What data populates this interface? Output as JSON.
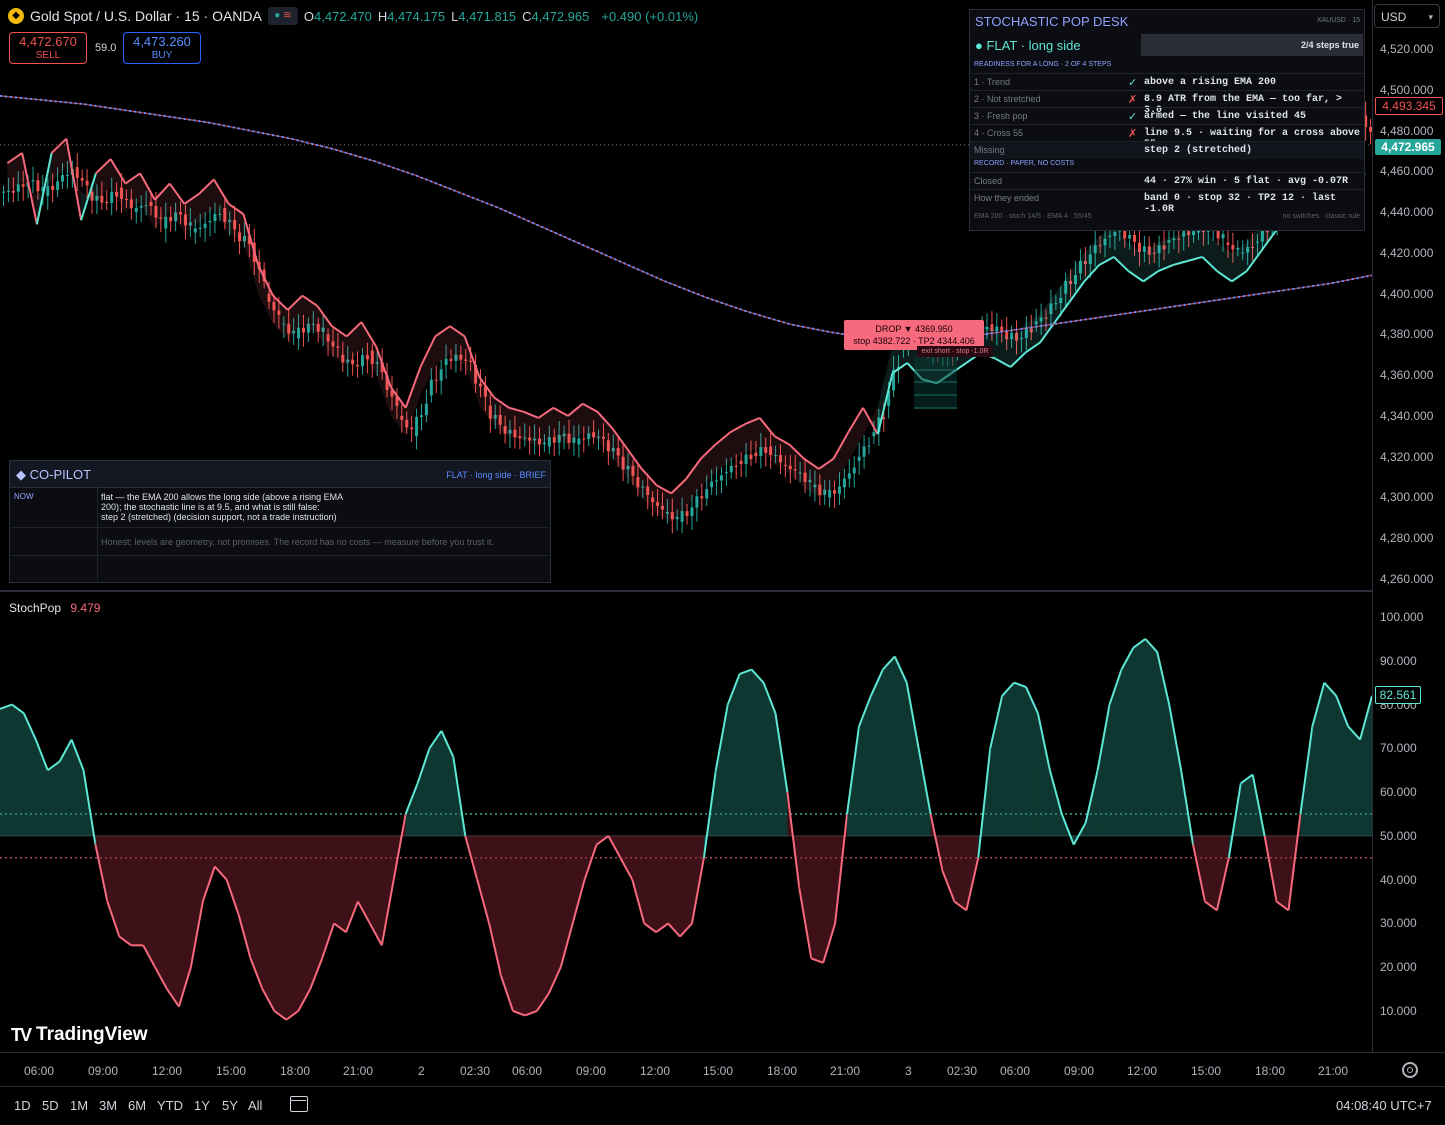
{
  "header": {
    "symbol": "Gold Spot / U.S. Dollar · 15 · OANDA",
    "ohlc": [
      {
        "k": "O",
        "v": "4,472.470"
      },
      {
        "k": "H",
        "v": "4,474.175"
      },
      {
        "k": "L",
        "v": "4,471.815"
      },
      {
        "k": "C",
        "v": "4,472.965"
      }
    ],
    "change": "+0.490 (+0.01%)",
    "sell_price": "4,472.670",
    "sell_label": "SELL",
    "spread": "59.0",
    "buy_price": "4,473.260",
    "buy_label": "BUY",
    "currency": "USD"
  },
  "desk": {
    "title": "STOCHASTIC POP DESK",
    "symbol_tag": "XAUUSD · 15",
    "state": "● FLAT · long side",
    "steps_summary": "2/4 steps true",
    "readiness_header": "READINESS FOR A LONG · 2 OF 4 STEPS",
    "rows": [
      {
        "label": "1 · Trend",
        "mark": "✓",
        "ok": true,
        "value": "above a rising EMA 200"
      },
      {
        "label": "2 · Not stretched",
        "mark": "✗",
        "ok": false,
        "value": "8.9 ATR from the EMA — too far, > 3.0"
      },
      {
        "label": "3 · Fresh pop",
        "mark": "✓",
        "ok": true,
        "value": "armed — the line visited 45"
      },
      {
        "label": "4 · Cross 55",
        "mark": "✗",
        "ok": false,
        "value": "line 9.5 · waiting for a cross above 55"
      },
      {
        "label": "Missing",
        "mark": "",
        "ok": true,
        "value": "step 2 (stretched)"
      }
    ],
    "record_header": "RECORD · PAPER, NO COSTS",
    "record_rows": [
      {
        "label": "Closed",
        "value": "44 · 27% win · 5 flat · avg -0.07R"
      },
      {
        "label": "How they ended",
        "value": "band 0 · stop 32 · TP2 12 · last -1.0R"
      }
    ],
    "footer_left": "EMA 200 · stoch 14/5 · EMA 4 · 55/45",
    "footer_right": "no switches · classic rule"
  },
  "copilot": {
    "title": "◆ CO-PILOT",
    "tag": "FLAT · long side · BRIEF",
    "now_label": "NOW",
    "now_lines": [
      "flat — the EMA 200 allows the long side (above a rising EMA",
      "200); the stochastic line is at 9.5, and what is still false:",
      "step 2 (stretched) (decision support, not a trade instruction)"
    ],
    "honest": "Honest: levels are geometry, not promises. The record has no costs — measure before you trust it."
  },
  "trade_label": {
    "line1": "DROP ▼  4369.950",
    "line2": "stop 4382.722 · TP2 4344.406",
    "exit": "exit short · stop -1.0R"
  },
  "price_axis": {
    "ticks": [
      "4,520.000",
      "4,500.000",
      "4,480.000",
      "4,460.000",
      "4,440.000",
      "4,420.000",
      "4,400.000",
      "4,380.000",
      "4,360.000",
      "4,340.000",
      "4,320.000",
      "4,300.000",
      "4,280.000",
      "4,260.000"
    ],
    "tag_high": "4,493.345",
    "tag_last": "4,472.965"
  },
  "osc": {
    "title": "StochPop",
    "value": "9.479",
    "ticks": [
      "100.000",
      "90.000",
      "80.000",
      "70.000",
      "60.000",
      "50.000",
      "40.000",
      "30.000",
      "20.000",
      "10.000"
    ],
    "tag": "82.561"
  },
  "time_axis": [
    "06:00",
    "09:00",
    "12:00",
    "15:00",
    "18:00",
    "21:00",
    "2",
    "02:30",
    "06:00",
    "09:00",
    "12:00",
    "15:00",
    "18:00",
    "21:00",
    "3",
    "02:30",
    "06:00",
    "09:00",
    "12:00",
    "15:00",
    "18:00",
    "21:00"
  ],
  "ranges": [
    "1D",
    "5D",
    "1M",
    "3M",
    "6M",
    "YTD",
    "1Y",
    "5Y",
    "All"
  ],
  "clock": "04:08:40 UTC+7",
  "brand": "TradingView",
  "colors": {
    "bull": "#26a69a",
    "bear": "#ef5350",
    "accent": "#2962ff",
    "band_up": "#5ee7d5",
    "band_down": "#f7697c"
  },
  "chart_data": [
    {
      "type": "candlestick",
      "title": "Gold Spot / U.S. Dollar · 15 · OANDA",
      "ylim": [
        4255,
        4530
      ],
      "close_path": [
        4450,
        4455,
        4448,
        4455,
        4462,
        4450,
        4445,
        4452,
        4440,
        4445,
        4432,
        4440,
        4430,
        4435,
        4442,
        4430,
        4425,
        4400,
        4385,
        4378,
        4385,
        4380,
        4370,
        4365,
        4372,
        4360,
        4340,
        4330,
        4350,
        4365,
        4370,
        4365,
        4345,
        4335,
        4330,
        4328,
        4325,
        4330,
        4326,
        4332,
        4328,
        4320,
        4310,
        4300,
        4292,
        4288,
        4295,
        4305,
        4312,
        4318,
        4322,
        4325,
        4316,
        4312,
        4305,
        4300,
        4305,
        4318,
        4330,
        4345,
        4375,
        4380,
        4372,
        4370,
        4375,
        4380,
        4385,
        4382,
        4378,
        4385,
        4390,
        4400,
        4410,
        4420,
        4428,
        4432,
        4425,
        4420,
        4425,
        4428,
        4430,
        4432,
        4425,
        4420,
        4425,
        4435,
        4445,
        4455,
        4465,
        4475,
        4485,
        4495,
        4472
      ],
      "ema_200": [
        4497,
        4495,
        4493,
        4490,
        4487,
        4484,
        4480,
        4476,
        4471,
        4465,
        4458,
        4450,
        4442,
        4433,
        4424,
        4415,
        4406,
        4398,
        4391,
        4385,
        4381,
        4378,
        4377,
        4378,
        4381,
        4384,
        4387,
        4390,
        4393,
        4396,
        4399,
        4402,
        4405,
        4409
      ],
      "last": 4472.965
    },
    {
      "type": "line",
      "title": "StochPop",
      "ylim": [
        0,
        100
      ],
      "levels": [
        55,
        50,
        45
      ],
      "values": [
        79,
        80,
        78,
        72,
        65,
        67,
        72,
        65,
        48,
        35,
        27,
        25,
        25,
        20,
        15,
        11,
        20,
        35,
        43,
        40,
        32,
        22,
        15,
        10,
        8,
        10,
        15,
        22,
        30,
        28,
        35,
        30,
        25,
        40,
        55,
        62,
        70,
        74,
        68,
        50,
        40,
        30,
        18,
        10,
        9,
        10,
        14,
        20,
        30,
        40,
        48,
        50,
        45,
        40,
        30,
        28,
        30,
        27,
        30,
        45,
        65,
        80,
        87,
        88,
        85,
        78,
        60,
        38,
        22,
        21,
        30,
        55,
        75,
        82,
        88,
        91,
        85,
        70,
        55,
        42,
        35,
        33,
        45,
        70,
        82,
        85,
        84,
        78,
        65,
        55,
        48,
        53,
        65,
        80,
        88,
        93,
        95,
        92,
        80,
        65,
        48,
        35,
        33,
        45,
        62,
        64,
        50,
        35,
        33,
        55,
        75,
        85,
        82,
        75,
        72,
        82
      ]
    }
  ]
}
